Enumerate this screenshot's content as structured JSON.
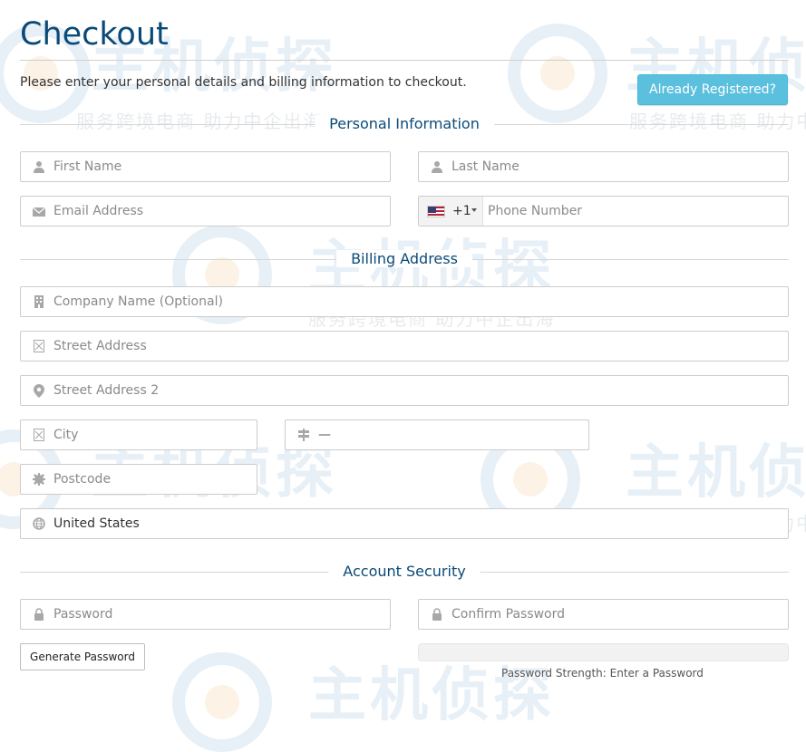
{
  "page": {
    "title": "Checkout",
    "intro": "Please enter your personal details and billing information to checkout."
  },
  "header": {
    "already_registered_label": "Already Registered?"
  },
  "sections": {
    "personal": "Personal Information",
    "billing": "Billing Address",
    "security": "Account Security"
  },
  "fields": {
    "first_name": {
      "placeholder": "First Name",
      "icon": "user-icon"
    },
    "last_name": {
      "placeholder": "Last Name",
      "icon": "user-icon"
    },
    "email": {
      "placeholder": "Email Address",
      "icon": "envelope-icon"
    },
    "phone": {
      "placeholder": "Phone Number",
      "dial_code": "+1",
      "country_flag": "us-flag-icon"
    },
    "company": {
      "placeholder": "Company Name (Optional)",
      "icon": "building-icon"
    },
    "street1": {
      "placeholder": "Street Address",
      "icon": "address-card-icon"
    },
    "street2": {
      "placeholder": "Street Address 2",
      "icon": "map-marker-icon"
    },
    "city": {
      "placeholder": "City",
      "icon": "address-card-icon"
    },
    "state": {
      "value": "—",
      "icon": "signpost-icon"
    },
    "postcode": {
      "placeholder": "Postcode",
      "icon": "certificate-icon"
    },
    "country": {
      "value": "United States",
      "icon": "globe-icon"
    },
    "password": {
      "placeholder": "Password",
      "icon": "lock-icon"
    },
    "confirm_password": {
      "placeholder": "Confirm Password",
      "icon": "lock-icon"
    }
  },
  "security": {
    "generate_label": "Generate Password",
    "strength_text": "Password Strength: Enter a Password"
  },
  "watermark": {
    "brand": "主机侦探",
    "slogan": "服务跨境电商  助力中企出海"
  },
  "colors": {
    "heading": "#0a4a78",
    "accent_button": "#5bc0de",
    "border": "#cccccc"
  }
}
